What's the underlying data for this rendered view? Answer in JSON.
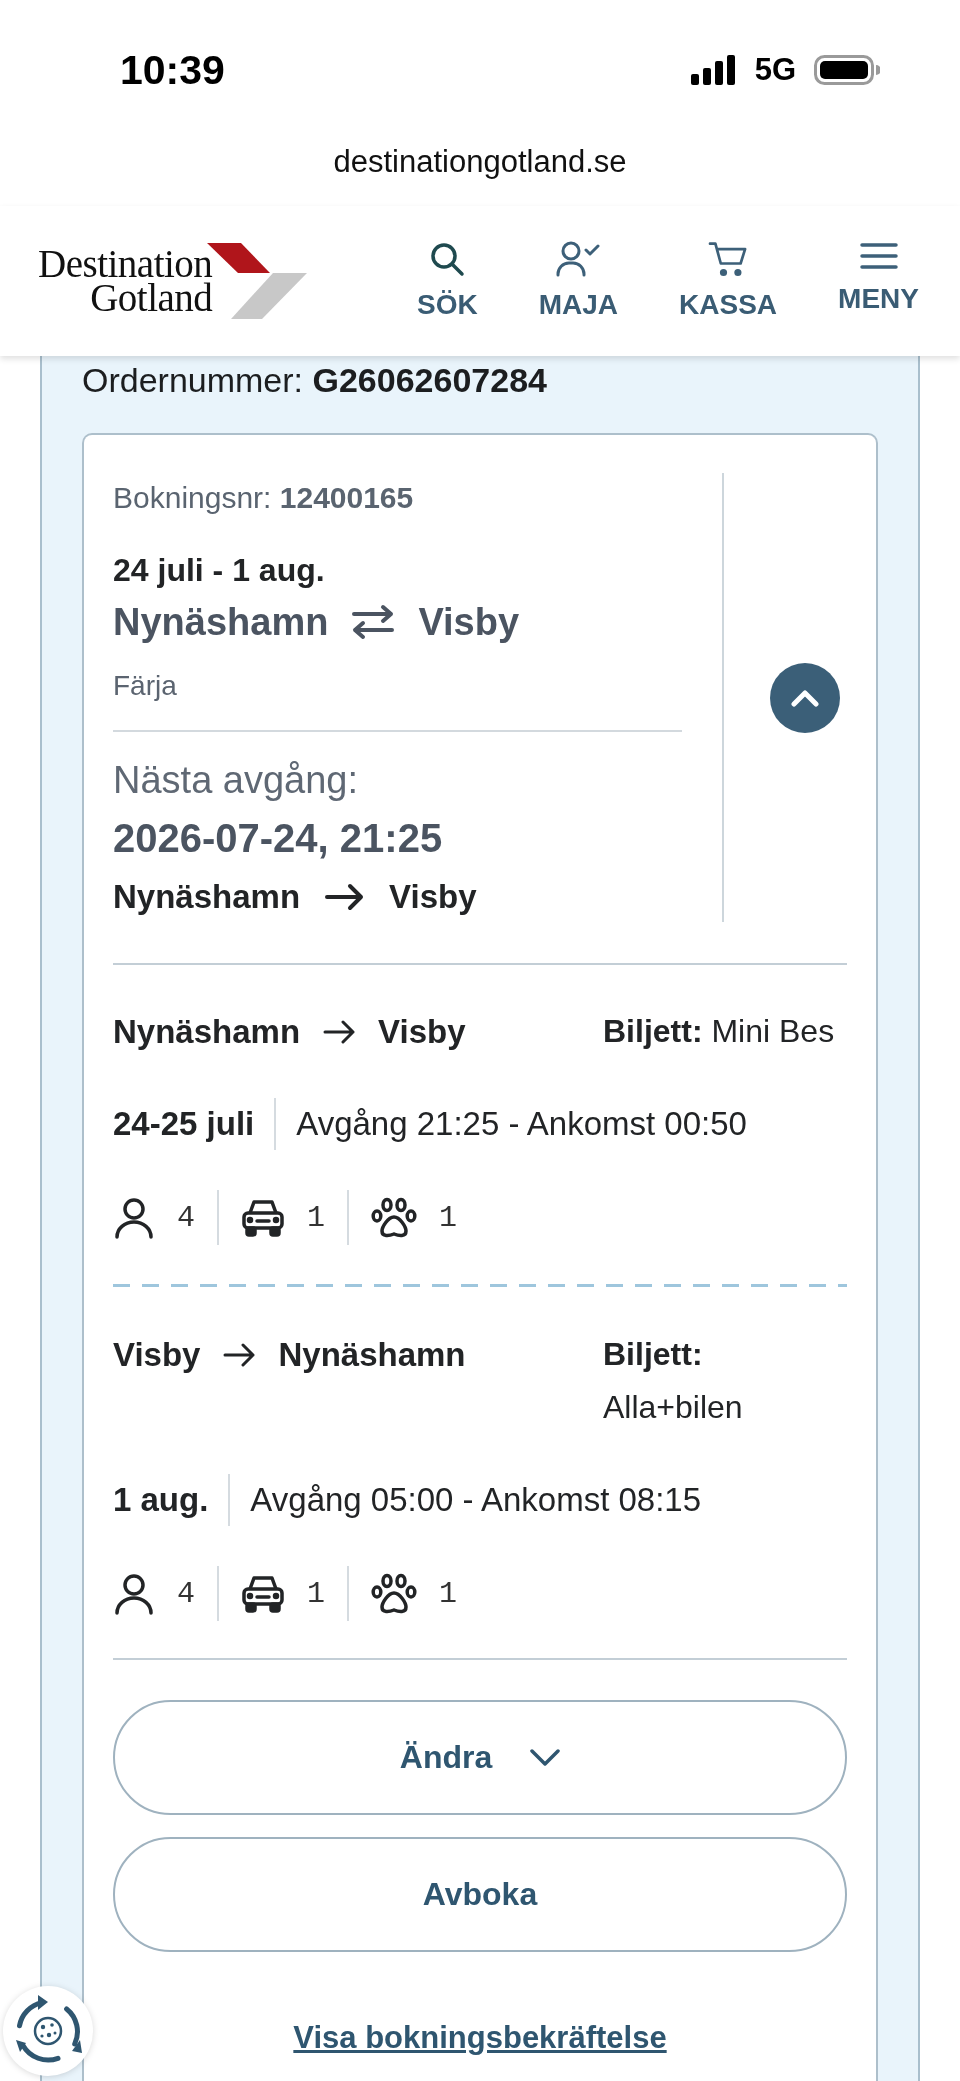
{
  "status_bar": {
    "time": "10:39",
    "network": "5G"
  },
  "browser": {
    "url": "destinationgotland.se"
  },
  "header": {
    "logo": [
      "Destination",
      "Gotland"
    ],
    "nav": [
      {
        "label": "SÖK",
        "kind": "search"
      },
      {
        "label": "MAJA",
        "kind": "account"
      },
      {
        "label": "KASSA",
        "kind": "cart"
      },
      {
        "label": "MENY",
        "kind": "menu"
      }
    ]
  },
  "order": {
    "text": "Ordernummer: **G26062607284**"
  },
  "booking": {
    "number": "Bokningsnr: **12400165**",
    "dates": "24 juli - 1 aug.",
    "origin": "Nynäshamn",
    "destination": "Visby",
    "transport": "Färja",
    "expanded": true
  },
  "next_departure": {
    "label": "Nästa avgång:",
    "datetime": "2026-07-24, 21:25",
    "from": "Nynäshamn",
    "to": "Visby"
  },
  "legs": [
    {
      "from": "Nynäshamn",
      "to": "Visby",
      "ticket": "**Biljett:** Mini Bes",
      "date": "24-25 juli",
      "times": "Avgång 21:25 - Ankomst 00:50",
      "counts": [
        {
          "kind": "person",
          "value": "4"
        },
        {
          "kind": "car",
          "value": "1"
        },
        {
          "kind": "pet",
          "value": "1"
        }
      ]
    },
    {
      "from": "Visby",
      "to": "Nynäshamn",
      "ticket": "**Biljett:** Alla+bilen",
      "date": "1 aug.",
      "times": "Avgång 05:00 - Ankomst 08:15",
      "counts": [
        {
          "kind": "person",
          "value": "4"
        },
        {
          "kind": "car",
          "value": "1"
        },
        {
          "kind": "pet",
          "value": "1"
        }
      ]
    }
  ],
  "actions": [
    {
      "label": "Ändra",
      "kind": "dropdown"
    },
    {
      "label": "Avboka",
      "kind": "plain"
    }
  ],
  "confirmation_link": "Visa bokningsbekräftelse"
}
